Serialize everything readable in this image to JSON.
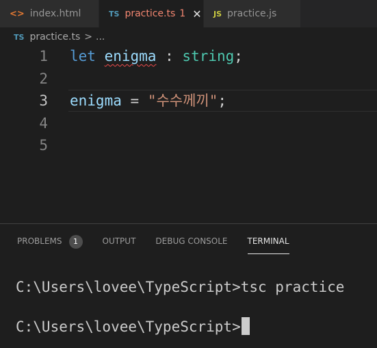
{
  "tabs": [
    {
      "icon": "<>",
      "label": "index.html"
    },
    {
      "icon": "TS",
      "label": "practice.ts",
      "problems": "1",
      "close": "✕"
    },
    {
      "icon": "JS",
      "label": "practice.js"
    }
  ],
  "breadcrumb": {
    "icon": "TS",
    "file": "practice.ts",
    "separator": ">",
    "more": "..."
  },
  "editor": {
    "line_numbers": [
      "1",
      "2",
      "3",
      "4",
      "5"
    ],
    "line1": {
      "kw": "let",
      "name": "enigma",
      "colon": ":",
      "type": "string",
      "semi": ";"
    },
    "line3": {
      "name": "enigma",
      "eq": "=",
      "value": "\"수수께끼\"",
      "semi": ";"
    }
  },
  "panel": {
    "tabs": [
      "PROBLEMS",
      "OUTPUT",
      "DEBUG CONSOLE",
      "TERMINAL"
    ],
    "problems_count": "1",
    "terminal_lines": [
      "C:\\Users\\lovee\\TypeScript>tsc practice",
      "C:\\Users\\lovee\\TypeScript>"
    ]
  }
}
